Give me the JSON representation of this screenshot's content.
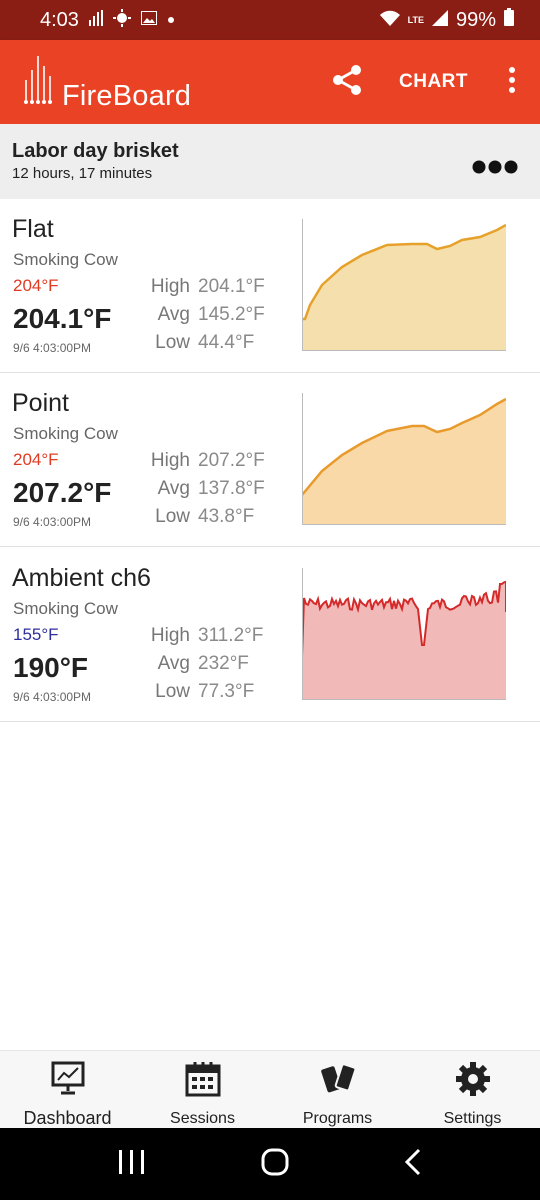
{
  "status_bar": {
    "time": "4:03",
    "network": "LTE",
    "battery": "99%"
  },
  "app_bar": {
    "logo_text": "FireBoard",
    "chart_label": "CHART"
  },
  "session": {
    "title": "Labor day brisket",
    "duration": "12 hours, 17 minutes"
  },
  "probes": [
    {
      "name": "Flat",
      "device": "Smoking Cow",
      "target": "204°F",
      "target_color": "#e03a22",
      "temp": "204.1°F",
      "time": "9/6 4:03:00PM",
      "high_label": "High",
      "high": "204.1°F",
      "avg_label": "Avg",
      "avg": "145.2°F",
      "low_label": "Low",
      "low": "44.4°F",
      "chart_color": "#e6a12b",
      "chart_fill": "#f5e0ad"
    },
    {
      "name": "Point",
      "device": "Smoking Cow",
      "target": "204°F",
      "target_color": "#e03a22",
      "temp": "207.2°F",
      "time": "9/6 4:03:00PM",
      "high_label": "High",
      "high": "207.2°F",
      "avg_label": "Avg",
      "avg": "137.8°F",
      "low_label": "Low",
      "low": "43.8°F",
      "chart_color": "#e89a2c",
      "chart_fill": "#fad9a8"
    },
    {
      "name": "Ambient ch6",
      "device": "Smoking Cow",
      "target": "155°F",
      "target_color": "#2d2f9c",
      "temp": "190°F",
      "time": "9/6 4:03:00PM",
      "high_label": "High",
      "high": "311.2°F",
      "avg_label": "Avg",
      "avg": "232°F",
      "low_label": "Low",
      "low": "77.3°F",
      "chart_color": "#d42a2a",
      "chart_fill": "#f2b9b9"
    }
  ],
  "bottom_nav": [
    {
      "label": "Dashboard",
      "icon": "dashboard-icon",
      "active": true
    },
    {
      "label": "Sessions",
      "icon": "calendar-icon",
      "active": false
    },
    {
      "label": "Programs",
      "icon": "cards-icon",
      "active": false
    },
    {
      "label": "Settings",
      "icon": "gear-icon",
      "active": false
    }
  ]
}
